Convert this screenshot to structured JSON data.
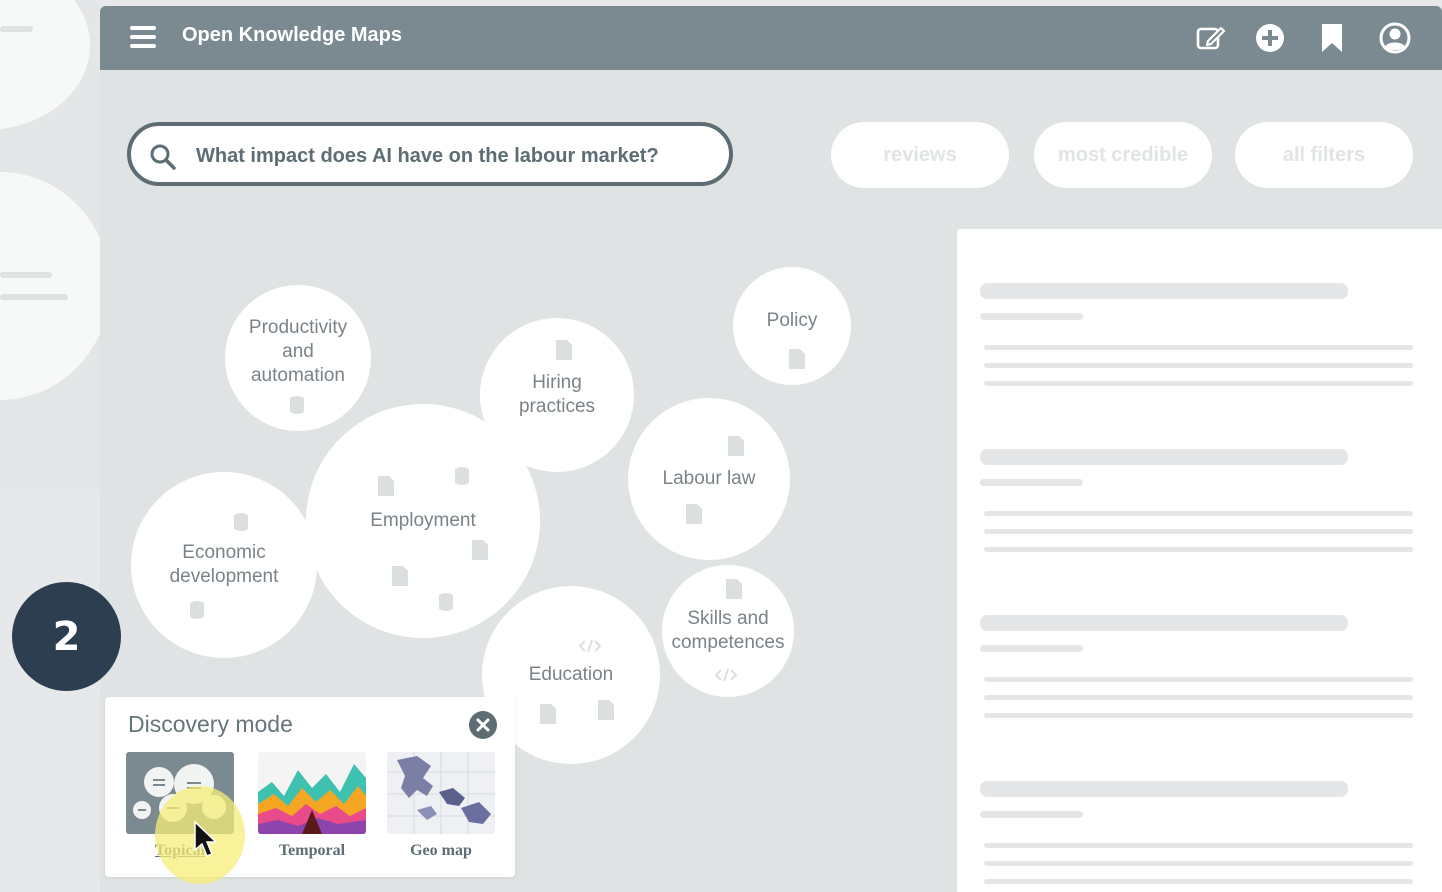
{
  "app": {
    "title": "Open Knowledge Maps"
  },
  "topbar": {
    "icons": [
      "edit-icon",
      "add-icon",
      "bookmark-icon",
      "account-icon"
    ]
  },
  "search": {
    "query": "What impact does AI have on the labour market?"
  },
  "filters": [
    {
      "label": "reviews"
    },
    {
      "label": "most credible"
    },
    {
      "label": "all filters"
    }
  ],
  "map": {
    "bubbles": [
      {
        "label": "Productivity and automation"
      },
      {
        "label": "Hiring practices"
      },
      {
        "label": "Policy"
      },
      {
        "label": "Labour law"
      },
      {
        "label": "Employment"
      },
      {
        "label": "Economic development"
      },
      {
        "label": "Skills and competences"
      },
      {
        "label": "Education"
      }
    ]
  },
  "step": {
    "number": "2"
  },
  "discovery": {
    "title": "Discovery mode",
    "modes": [
      {
        "label": "Topical"
      },
      {
        "label": "Temporal"
      },
      {
        "label": "Geo map"
      }
    ]
  },
  "colors": {
    "topbar": "#7a8a90",
    "badge": "#2c3e50",
    "highlight": "#f5ee78"
  }
}
